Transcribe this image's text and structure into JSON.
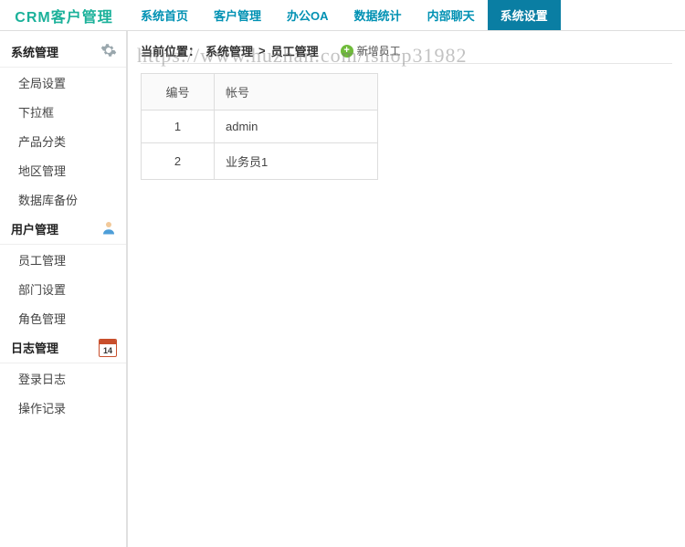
{
  "brand": "CRM客户管理",
  "topnav": [
    {
      "label": "系统首页",
      "active": false
    },
    {
      "label": "客户管理",
      "active": false
    },
    {
      "label": "办公OA",
      "active": false
    },
    {
      "label": "数据统计",
      "active": false
    },
    {
      "label": "内部聊天",
      "active": false
    },
    {
      "label": "系统设置",
      "active": true
    }
  ],
  "sidebar": {
    "groups": [
      {
        "title": "系统管理",
        "icon": "gear",
        "items": [
          "全局设置",
          "下拉框",
          "产品分类",
          "地区管理",
          "数据库备份"
        ]
      },
      {
        "title": "用户管理",
        "icon": "user",
        "items": [
          "员工管理",
          "部门设置",
          "角色管理"
        ]
      },
      {
        "title": "日志管理",
        "icon": "calendar",
        "cal": "14",
        "items": [
          "登录日志",
          "操作记录"
        ]
      }
    ]
  },
  "breadcrumb": {
    "prefix": "当前位置：",
    "path1": "系统管理",
    "sep": ">",
    "path2": "员工管理"
  },
  "add_action": "新增员工",
  "table": {
    "headers": [
      "编号",
      "帐号"
    ],
    "rows": [
      {
        "id": "1",
        "account": "admin"
      },
      {
        "id": "2",
        "account": "业务员1"
      }
    ]
  },
  "watermark": "https://www.huzhan.com/ishop31982"
}
